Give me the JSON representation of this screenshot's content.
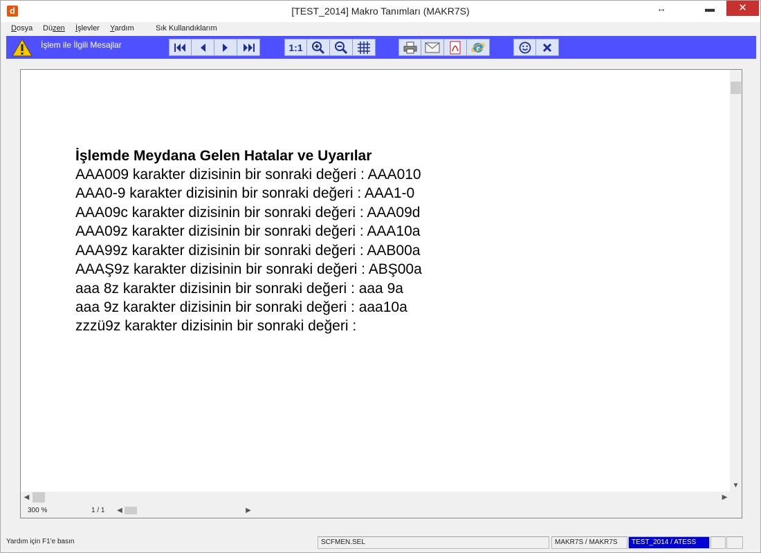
{
  "window": {
    "title": "[TEST_2014] Makro Tanımları (MAKR7S)",
    "app_icon_glyph": "d",
    "resize_glyph": "↔",
    "minimize_glyph": "▬",
    "close_glyph": "✕",
    "close_color": "#c7312f"
  },
  "menu": {
    "items": [
      {
        "first": "D",
        "rest": "osya"
      },
      {
        "first": "Dü",
        "rest": "zen",
        "underline_first": false
      },
      {
        "first": "İ",
        "rest": "şlevler"
      },
      {
        "first": "Y",
        "rest": "ardım"
      },
      {
        "first": "",
        "rest": "Sık Kullandıklarım"
      }
    ]
  },
  "toolbar": {
    "background": "#4f50ff",
    "label": "İşlem ile İlgili Mesajlar",
    "nav_buttons": [
      "first-page-icon",
      "previous-page-icon",
      "next-page-icon",
      "last-page-icon"
    ],
    "zoom_buttons": [
      "actual-size-icon",
      "zoom-in-icon",
      "zoom-out-icon",
      "grid-icon"
    ],
    "zoom_actual_label": "1:1",
    "output_buttons": [
      "print-icon",
      "email-icon",
      "pdf-icon",
      "internet-explorer-icon"
    ],
    "misc_buttons": [
      "smiley-icon",
      "close-x-icon"
    ]
  },
  "document": {
    "heading": "İşlemde Meydana Gelen Hatalar ve Uyarılar",
    "lines": [
      "AAA009 karakter dizisinin bir sonraki değeri : AAA010",
      "AAA0-9 karakter dizisinin bir sonraki değeri : AAA1-0",
      "AAA09c karakter dizisinin bir sonraki değeri : AAA09d",
      "AAA09z karakter dizisinin bir sonraki değeri : AAA10a",
      "AAA99z karakter dizisinin bir sonraki değeri : AAB00a",
      "AAAŞ9z karakter dizisinin bir sonraki değeri : ABŞ00a",
      "aaa 8z karakter dizisinin bir sonraki değeri : aaa 9a",
      "aaa 9z karakter dizisinin bir sonraki değeri : aaa10a",
      "zzzü9z karakter dizisinin bir sonraki değeri :"
    ],
    "zoom": "300 %",
    "page": "1 / 1"
  },
  "statusbar": {
    "help": "Yardım için F1'e basın",
    "file": "SCFMEN.SEL",
    "macro": "MAKR7S / MAKR7S",
    "company": "TEST_2014 / ATESS",
    "company_bg": "#0000d6"
  }
}
